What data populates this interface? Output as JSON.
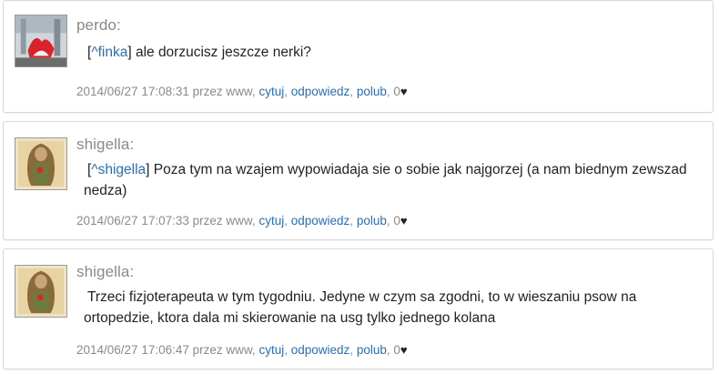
{
  "comments": [
    {
      "author": "perdo:",
      "ref_open": "[",
      "ref_name": "^finka",
      "ref_close": "]",
      "text": " ale dorzucisz jeszcze nerki?",
      "timestamp": "2014/06/27 17:08:31",
      "by_text": "przez www,",
      "action_cite": "cytuj",
      "action_reply": "odpowiedz",
      "action_like": "polub",
      "likes": "0"
    },
    {
      "author": "shigella:",
      "ref_open": "[",
      "ref_name": "^shigella",
      "ref_close": "]",
      "text": " Poza tym na wzajem wypowiadaja sie o sobie jak najgorzej (a nam biednym zewszad nedza)",
      "timestamp": "2014/06/27 17:07:33",
      "by_text": "przez www,",
      "action_cite": "cytuj",
      "action_reply": "odpowiedz",
      "action_like": "polub",
      "likes": "0"
    },
    {
      "author": "shigella:",
      "text": "Trzeci fizjoterapeuta w tym tygodniu. Jedyne w czym sa zgodni, to w wieszaniu psow na ortopedzie, ktora dala mi skierowanie na usg tylko jednego kolana",
      "timestamp": "2014/06/27 17:06:47",
      "by_text": "przez www,",
      "action_cite": "cytuj",
      "action_reply": "odpowiedz",
      "action_like": "polub",
      "likes": "0"
    }
  ],
  "icons": {
    "like": "heart-icon",
    "avatar_1": "avatar-photo",
    "avatar_2": "avatar-painting"
  },
  "colors": {
    "link": "#2a6db5",
    "author": "#8a8a8a",
    "border": "#d7d7d7"
  },
  "separators": {
    "comma": ",",
    "heart": "♥"
  }
}
